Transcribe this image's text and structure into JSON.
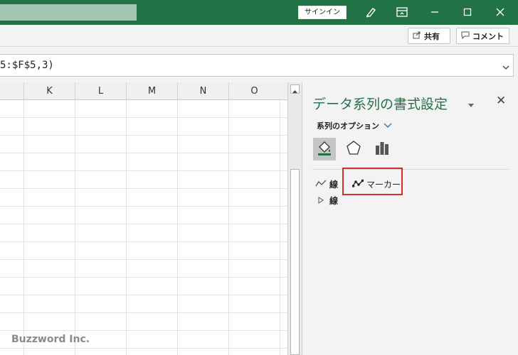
{
  "titlebar": {
    "signin_label": "サインイン"
  },
  "ribbon": {
    "share_label": "共有",
    "comment_label": "コメント"
  },
  "formula_bar": {
    "value": "5:$F$5,3)"
  },
  "grid": {
    "columns": [
      "K",
      "L",
      "M",
      "N",
      "O"
    ],
    "watermark": "Buzzword Inc."
  },
  "pane": {
    "title": "データ系列の書式設定",
    "options_label": "系列のオプション",
    "tabs": [
      {
        "icon": "fill-line-icon"
      },
      {
        "icon": "effects-icon"
      },
      {
        "icon": "series-options-icon"
      }
    ],
    "subtabs": {
      "line_label": "線",
      "marker_label": "マーカー"
    },
    "section_label": "線"
  },
  "colors": {
    "accent": "#217346",
    "highlight": "#d32f2f"
  }
}
